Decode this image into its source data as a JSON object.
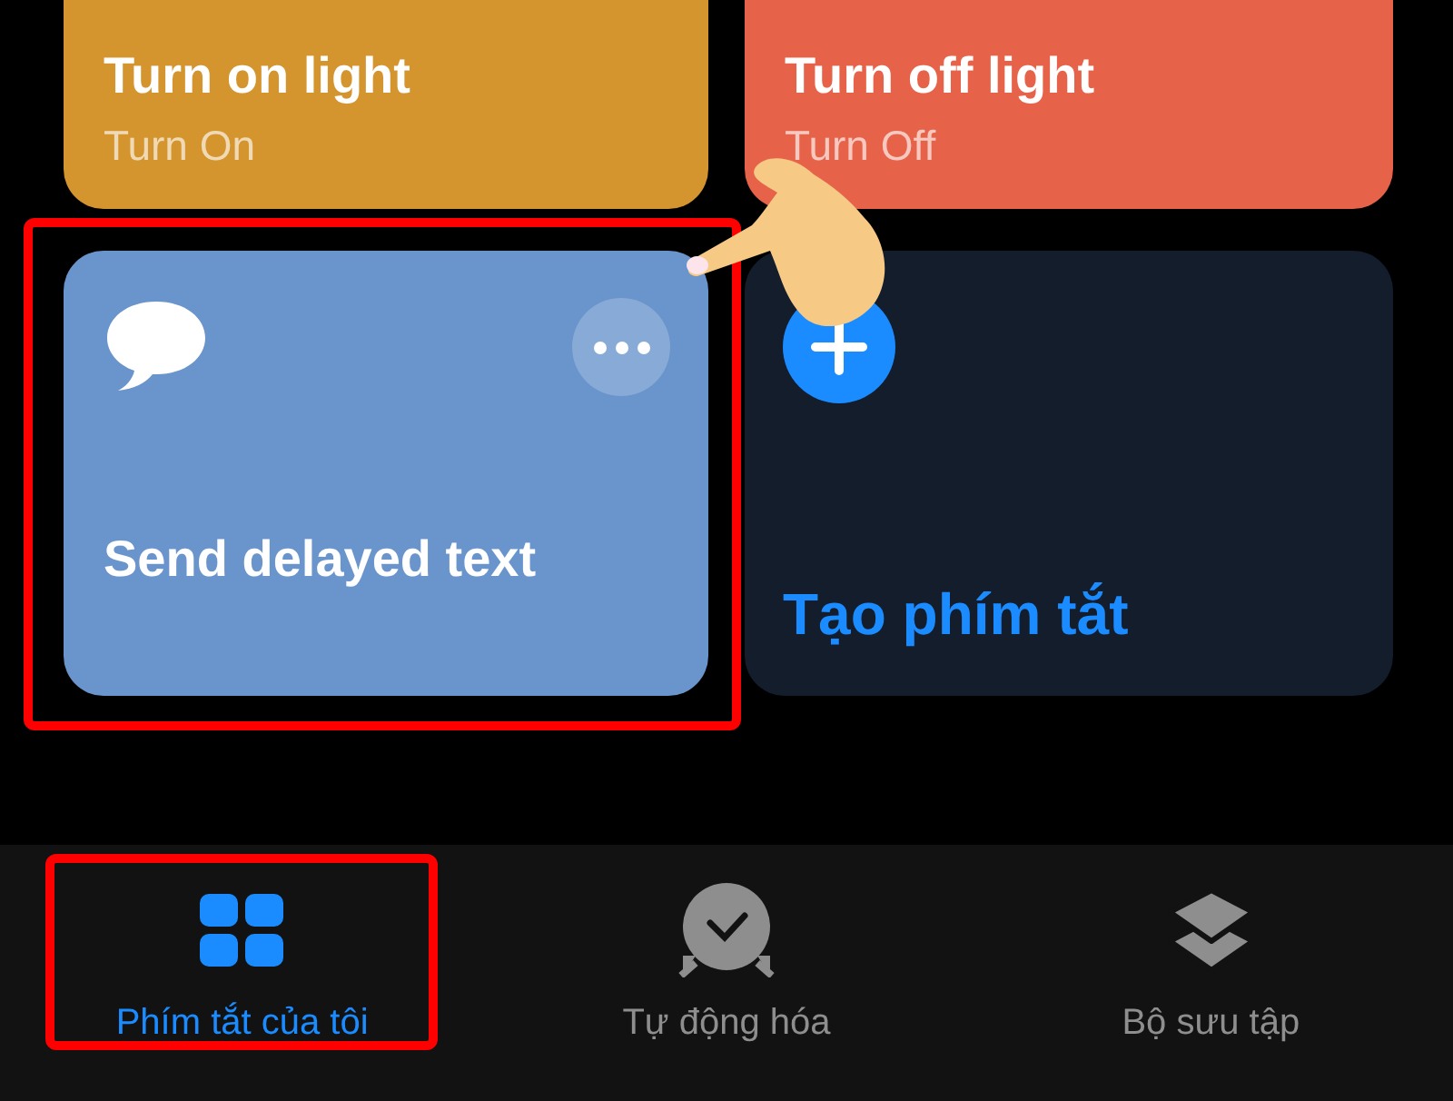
{
  "shortcuts": [
    {
      "kind": "shortcut",
      "title": "Turn on light",
      "subtitle": "Turn On",
      "color": "#d4952e",
      "highlighted": false
    },
    {
      "kind": "shortcut",
      "title": "Turn off light",
      "subtitle": "Turn Off",
      "color": "#e6634a",
      "highlighted": false
    },
    {
      "kind": "message_shortcut",
      "title": "Send delayed text",
      "color": "#6a95cc",
      "highlighted": true
    },
    {
      "kind": "create",
      "title": "Tạo phím tắt",
      "highlighted": false
    }
  ],
  "tab_bar": [
    {
      "label": "Phím tắt của tôi",
      "selected": true,
      "highlighted": true
    },
    {
      "label": "Tự động hóa",
      "selected": false,
      "highlighted": false
    },
    {
      "label": "Bộ sưu tập",
      "selected": false,
      "highlighted": false
    }
  ]
}
